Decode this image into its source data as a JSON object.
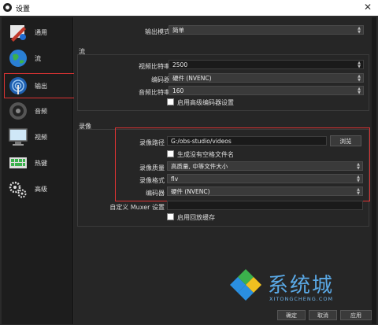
{
  "window": {
    "title": "设置"
  },
  "sidebar": {
    "items": [
      {
        "label": "通用"
      },
      {
        "label": "流"
      },
      {
        "label": "输出"
      },
      {
        "label": "音频"
      },
      {
        "label": "视频"
      },
      {
        "label": "热键"
      },
      {
        "label": "高级"
      }
    ]
  },
  "output_mode": {
    "label": "输出模式",
    "value": "简单"
  },
  "stream": {
    "title": "流",
    "bitrate_label": "视频比特率",
    "bitrate_value": "2500",
    "encoder_label": "编码器",
    "encoder_value": "硬件 (NVENC)",
    "audio_label": "音频比特率",
    "audio_value": "160",
    "advanced_label": "启用高级编码器设置"
  },
  "recording": {
    "title": "录像",
    "path_label": "录像路径",
    "path_value": "G:/obs-studio/videos",
    "browse_label": "浏览",
    "nospace_label": "生成没有空格文件名",
    "quality_label": "录像质量",
    "quality_value": "高质量, 中等文件大小",
    "format_label": "录像格式",
    "format_value": "flv",
    "encoder_label": "编码器",
    "encoder_value": "硬件 (NVENC)",
    "muxer_label": "自定义 Muxer 设置",
    "muxer_value": "",
    "replay_label": "启用回放缓存"
  },
  "footer": {
    "ok": "确定",
    "cancel": "取消",
    "apply": "应用"
  },
  "watermark": {
    "text": "系统城",
    "sub": "XITONGCHENG.COM"
  },
  "colors": {
    "highlight": "#dd3333",
    "bg": "#262626"
  }
}
